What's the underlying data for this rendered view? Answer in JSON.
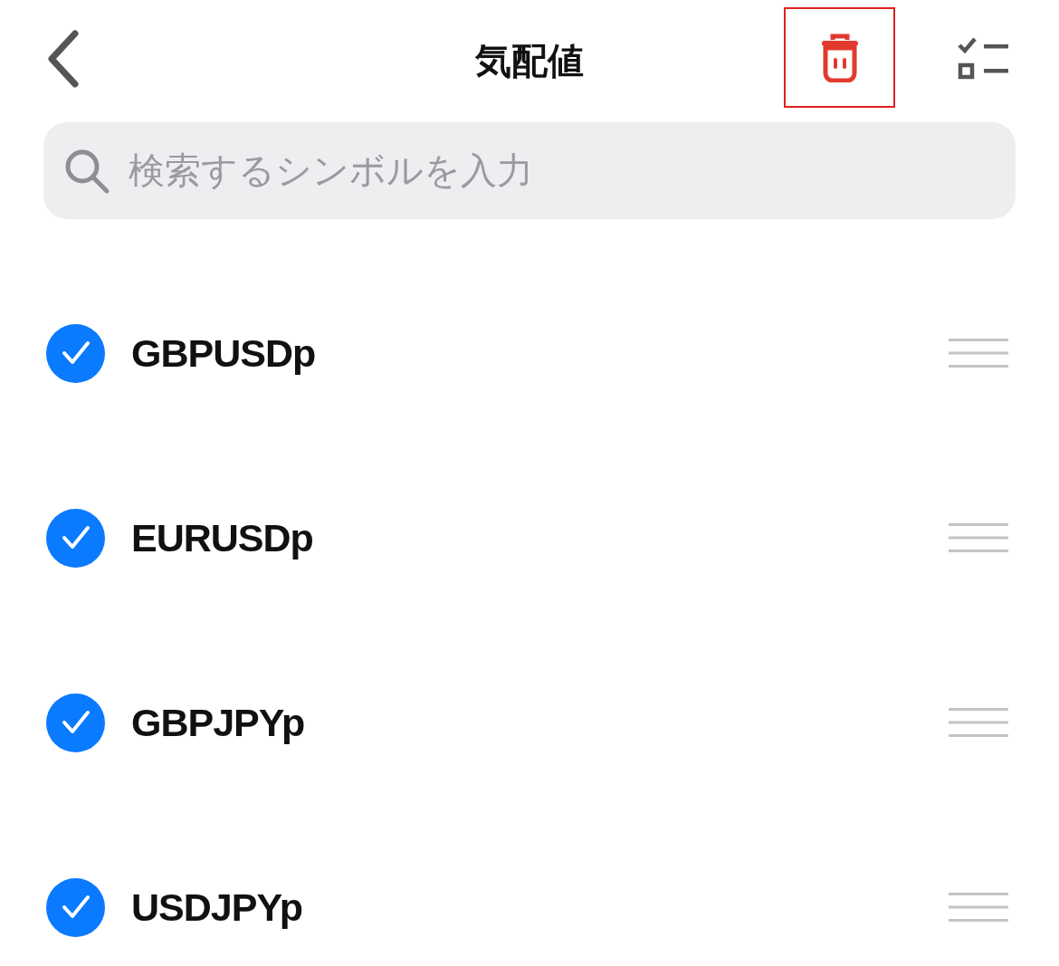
{
  "header": {
    "title": "気配値",
    "delete_highlighted": true
  },
  "search": {
    "placeholder": "検索するシンボルを入力"
  },
  "symbols": [
    {
      "name": "GBPUSDp",
      "checked": true
    },
    {
      "name": "EURUSDp",
      "checked": true
    },
    {
      "name": "GBPJPYp",
      "checked": true
    },
    {
      "name": "USDJPYp",
      "checked": true
    }
  ]
}
